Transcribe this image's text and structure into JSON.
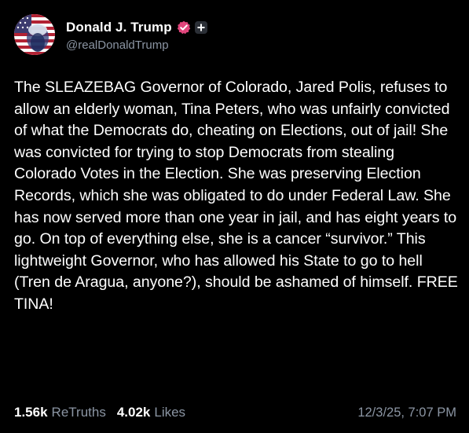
{
  "author": {
    "display_name": "Donald J. Trump",
    "handle": "@realDonaldTrump",
    "verified_color": "#e0457b"
  },
  "post": {
    "text": "The SLEAZEBAG Governor of Colorado, Jared Polis, refuses to allow an elderly woman, Tina Peters, who was unfairly convicted of what the Democrats do, cheating on Elections, out of jail! She was convicted for trying to stop Democrats from stealing Colorado Votes in the Election. She was preserving Election Records, which she was obligated to do under Federal Law. She has now served more than one year in jail, and has eight years to go. On top of everything else, she is a cancer “survivor.” This lightweight Governor, who has allowed his State to go to hell (Tren de Aragua, anyone?), should be ashamed of himself. FREE TINA!",
    "retruths_count": "1.56k",
    "retruths_label": "ReTruths",
    "likes_count": "4.02k",
    "likes_label": "Likes",
    "timestamp": "12/3/25, 7:07 PM"
  },
  "icons": {
    "avatar": "avatar-flag-portrait",
    "verified": "verified-badge-icon",
    "plus": "plus-badge-icon"
  },
  "colors": {
    "background": "#000000",
    "text": "#ffffff",
    "muted": "#8b95a3"
  }
}
